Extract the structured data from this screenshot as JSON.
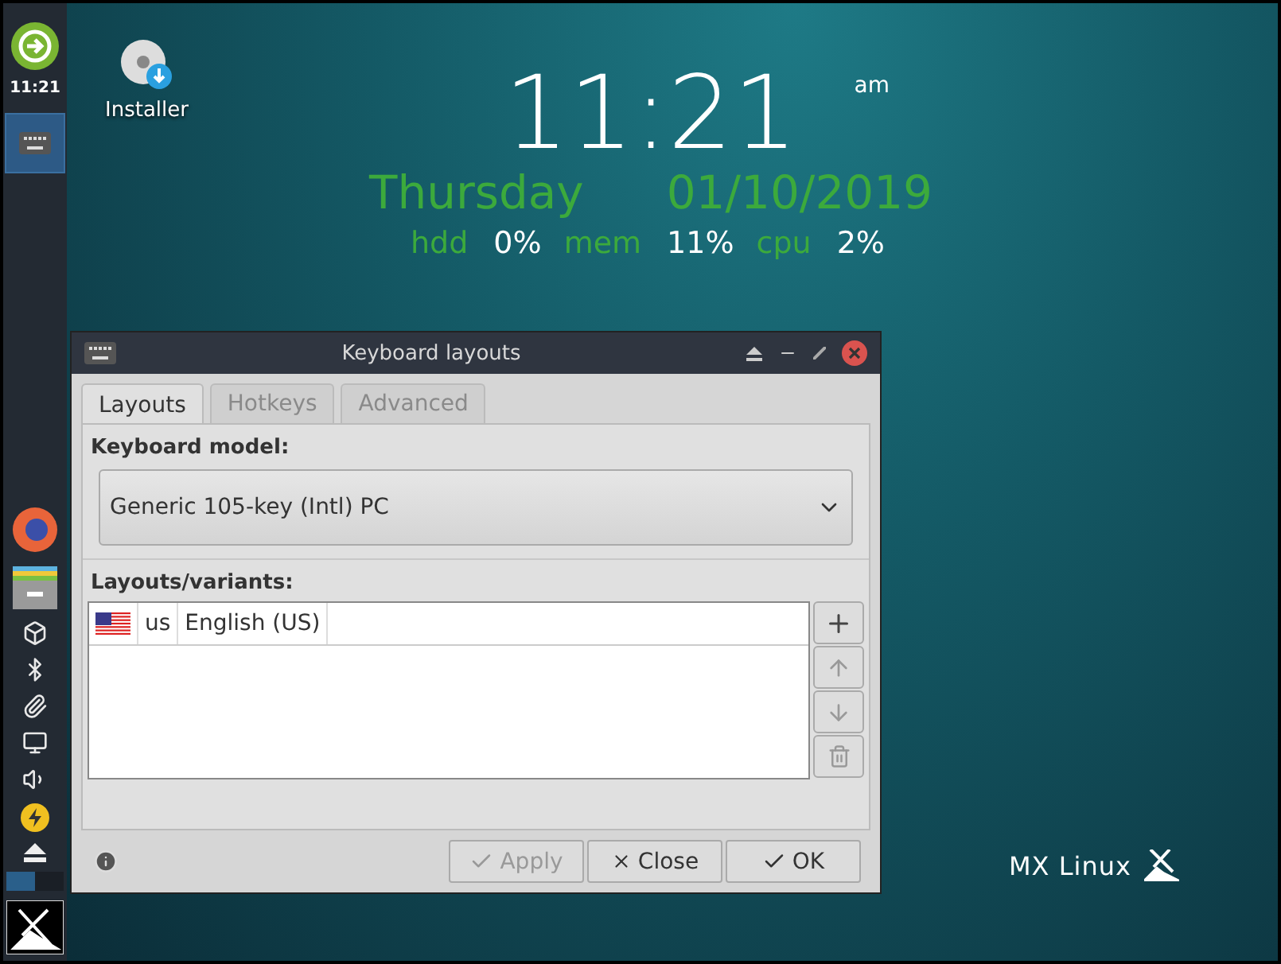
{
  "panel": {
    "clock": "11:21",
    "workspaces": [
      {
        "selected": true
      },
      {
        "selected": false
      }
    ]
  },
  "desktop_icons": [
    {
      "label": "Installer"
    }
  ],
  "conky": {
    "time": "11:21",
    "meridiem": "am",
    "day": "Thursday",
    "date": "01/10/2019",
    "stats": [
      {
        "label": "hdd",
        "value": "0%"
      },
      {
        "label": "mem",
        "value": "11%"
      },
      {
        "label": "cpu",
        "value": "2%"
      }
    ]
  },
  "window": {
    "title": "Keyboard layouts",
    "tabs": [
      {
        "label": "Layouts",
        "selected": true
      },
      {
        "label": "Hotkeys",
        "selected": false
      },
      {
        "label": "Advanced",
        "selected": false
      }
    ],
    "keyboard_model": {
      "label": "Keyboard model:",
      "value": "Generic 105-key (Intl) PC"
    },
    "layouts_label": "Layouts/variants:",
    "layouts": [
      {
        "code": "us",
        "name": "English (US)"
      }
    ],
    "side_buttons": [
      {
        "kind": "add",
        "disabled": false
      },
      {
        "kind": "up",
        "disabled": true
      },
      {
        "kind": "down",
        "disabled": true
      },
      {
        "kind": "remove",
        "disabled": true
      }
    ],
    "buttons": [
      {
        "kind": "apply",
        "label": "Apply",
        "disabled": true
      },
      {
        "kind": "close",
        "label": "Close",
        "disabled": false
      },
      {
        "kind": "ok",
        "label": "OK",
        "disabled": false
      }
    ]
  },
  "logo": {
    "text": "MX Linux"
  }
}
